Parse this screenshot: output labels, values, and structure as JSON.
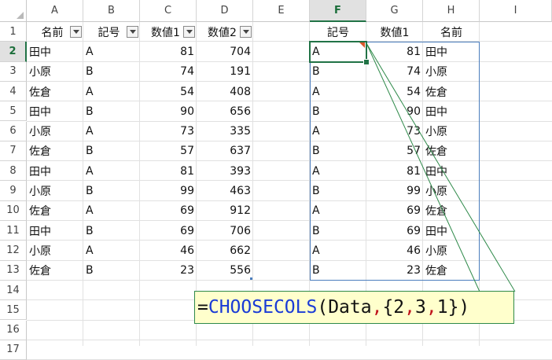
{
  "columns": [
    "A",
    "B",
    "C",
    "D",
    "E",
    "F",
    "G",
    "H",
    "I"
  ],
  "selected_column": "F",
  "rows": [
    "1",
    "2",
    "3",
    "4",
    "5",
    "6",
    "7",
    "8",
    "9",
    "10",
    "11",
    "12",
    "13",
    "14",
    "15",
    "16",
    "17"
  ],
  "selected_row": "2",
  "table_headers": [
    "名前",
    "記号",
    "数値1",
    "数値2"
  ],
  "table_rows": [
    [
      "田中",
      "A",
      "81",
      "704"
    ],
    [
      "小原",
      "B",
      "74",
      "191"
    ],
    [
      "佐倉",
      "A",
      "54",
      "408"
    ],
    [
      "田中",
      "B",
      "90",
      "656"
    ],
    [
      "小原",
      "A",
      "73",
      "335"
    ],
    [
      "佐倉",
      "B",
      "57",
      "637"
    ],
    [
      "田中",
      "A",
      "81",
      "393"
    ],
    [
      "小原",
      "B",
      "99",
      "463"
    ],
    [
      "佐倉",
      "A",
      "69",
      "912"
    ],
    [
      "田中",
      "B",
      "69",
      "706"
    ],
    [
      "小原",
      "A",
      "46",
      "662"
    ],
    [
      "佐倉",
      "B",
      "23",
      "556"
    ]
  ],
  "result_headers": [
    "記号",
    "数値1",
    "名前"
  ],
  "result_rows": [
    [
      "A",
      "81",
      "田中"
    ],
    [
      "B",
      "74",
      "小原"
    ],
    [
      "A",
      "54",
      "佐倉"
    ],
    [
      "B",
      "90",
      "田中"
    ],
    [
      "A",
      "73",
      "小原"
    ],
    [
      "B",
      "57",
      "佐倉"
    ],
    [
      "A",
      "81",
      "田中"
    ],
    [
      "B",
      "99",
      "小原"
    ],
    [
      "A",
      "69",
      "佐倉"
    ],
    [
      "B",
      "69",
      "田中"
    ],
    [
      "A",
      "46",
      "小原"
    ],
    [
      "B",
      "23",
      "佐倉"
    ]
  ],
  "formula": {
    "equals": "=",
    "function_name": "CHOOSECOLS",
    "open_paren": "(",
    "arg_range": "Data",
    "sep1": ",",
    "brace_open": " {2",
    "sep2": ",",
    "mid": "3",
    "sep3": ",",
    "tail": "1})"
  },
  "colors": {
    "accent": "#217346",
    "function_blue": "#1a3bd6",
    "separator_red": "#c0141c",
    "spill_border": "#4a7dbd",
    "callout_bg": "#ffffcc"
  }
}
